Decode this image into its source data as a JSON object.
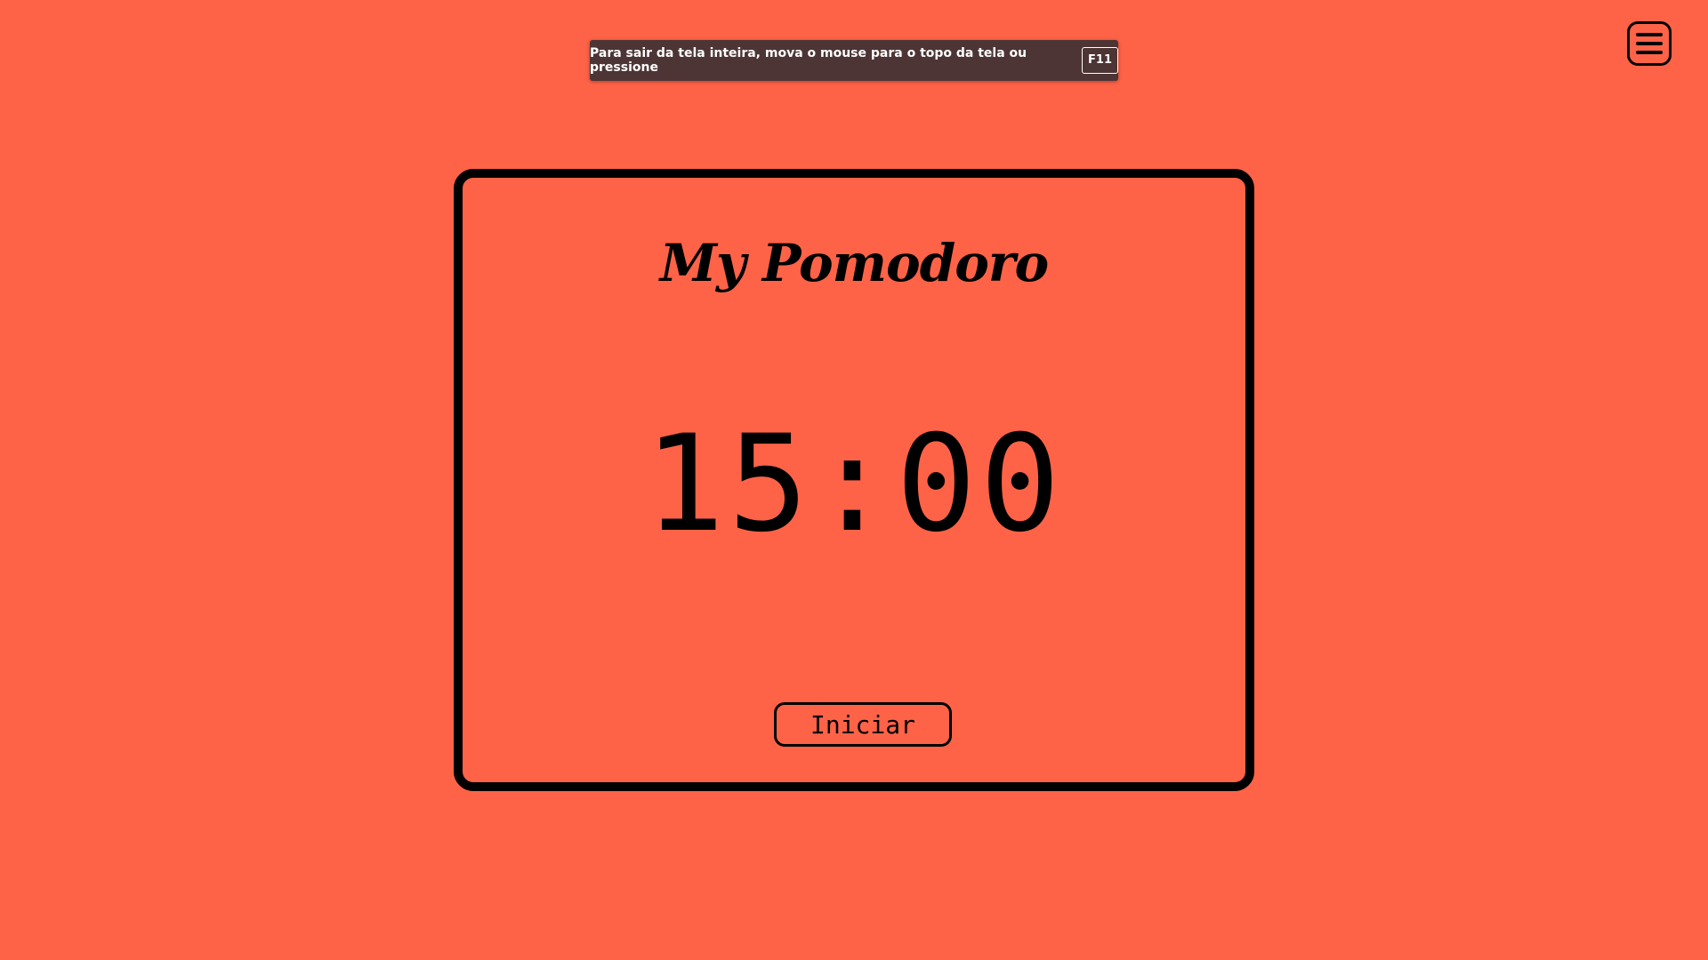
{
  "fullscreen_notice": {
    "message": "Para sair da tela inteira, mova o mouse para o topo da tela ou pressione",
    "key": "F11"
  },
  "menu": {
    "icon": "hamburger-menu-icon"
  },
  "card": {
    "title": "My Pomodoro",
    "timer": "15:00",
    "start_label": "Iniciar"
  },
  "colors": {
    "background": "#ff6347",
    "foreground": "#000000",
    "toast_background": "#4d3535"
  }
}
